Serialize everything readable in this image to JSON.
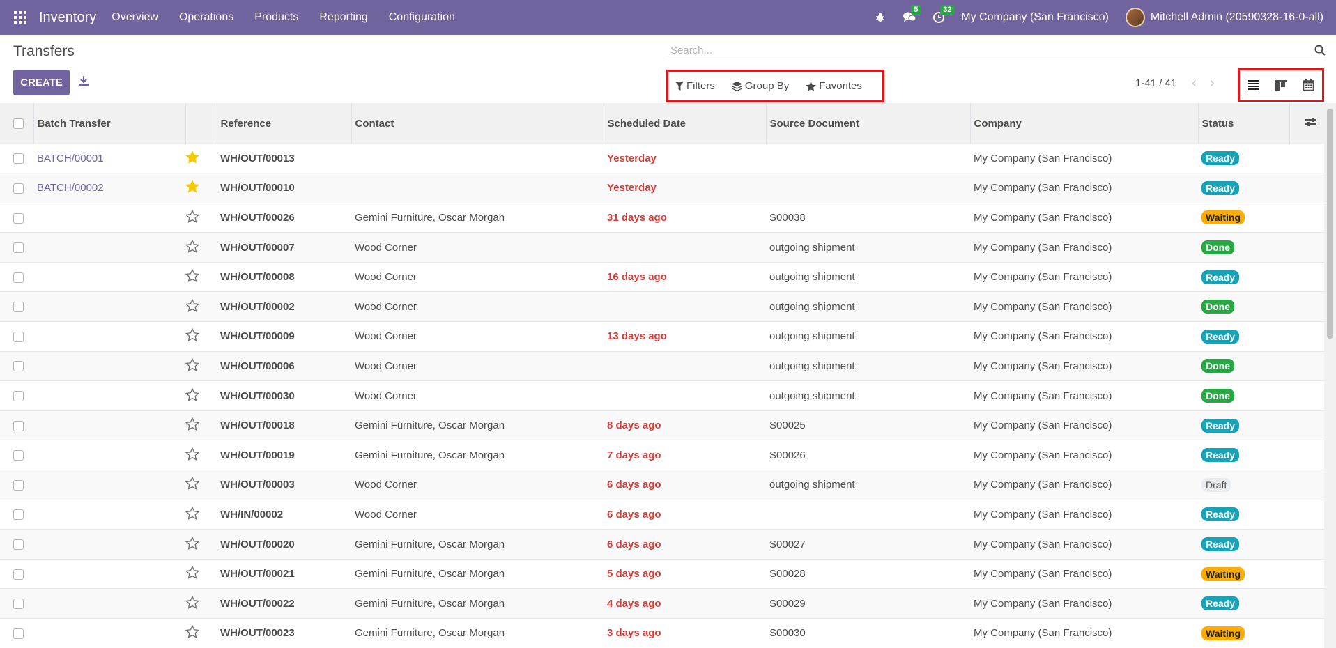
{
  "navbar": {
    "app_name": "Inventory",
    "menu": [
      "Overview",
      "Operations",
      "Products",
      "Reporting",
      "Configuration"
    ],
    "messages_count": "5",
    "activities_count": "32",
    "company": "My Company (San Francisco)",
    "user": "Mitchell Admin (20590328-16-0-all)"
  },
  "control_panel": {
    "title": "Transfers",
    "search_placeholder": "Search...",
    "create_label": "CREATE",
    "filters_label": "Filters",
    "group_by_label": "Group By",
    "favorites_label": "Favorites",
    "pager": "1-41 / 41"
  },
  "table": {
    "headers": [
      "Batch Transfer",
      "Reference",
      "Contact",
      "Scheduled Date",
      "Source Document",
      "Company",
      "Status"
    ],
    "rows": [
      {
        "batch": "BATCH/00001",
        "starred": true,
        "reference": "WH/OUT/00013",
        "contact": "",
        "date": "Yesterday",
        "source": "",
        "company": "My Company (San Francisco)",
        "status": "Ready"
      },
      {
        "batch": "BATCH/00002",
        "starred": true,
        "reference": "WH/OUT/00010",
        "contact": "",
        "date": "Yesterday",
        "source": "",
        "company": "My Company (San Francisco)",
        "status": "Ready"
      },
      {
        "batch": "",
        "starred": false,
        "reference": "WH/OUT/00026",
        "contact": "Gemini Furniture, Oscar Morgan",
        "date": "31 days ago",
        "source": "S00038",
        "company": "My Company (San Francisco)",
        "status": "Waiting"
      },
      {
        "batch": "",
        "starred": false,
        "reference": "WH/OUT/00007",
        "contact": "Wood Corner",
        "date": "",
        "source": "outgoing shipment",
        "company": "My Company (San Francisco)",
        "status": "Done"
      },
      {
        "batch": "",
        "starred": false,
        "reference": "WH/OUT/00008",
        "contact": "Wood Corner",
        "date": "16 days ago",
        "source": "outgoing shipment",
        "company": "My Company (San Francisco)",
        "status": "Ready"
      },
      {
        "batch": "",
        "starred": false,
        "reference": "WH/OUT/00002",
        "contact": "Wood Corner",
        "date": "",
        "source": "outgoing shipment",
        "company": "My Company (San Francisco)",
        "status": "Done"
      },
      {
        "batch": "",
        "starred": false,
        "reference": "WH/OUT/00009",
        "contact": "Wood Corner",
        "date": "13 days ago",
        "source": "outgoing shipment",
        "company": "My Company (San Francisco)",
        "status": "Ready"
      },
      {
        "batch": "",
        "starred": false,
        "reference": "WH/OUT/00006",
        "contact": "Wood Corner",
        "date": "",
        "source": "outgoing shipment",
        "company": "My Company (San Francisco)",
        "status": "Done"
      },
      {
        "batch": "",
        "starred": false,
        "reference": "WH/OUT/00030",
        "contact": "Wood Corner",
        "date": "",
        "source": "outgoing shipment",
        "company": "My Company (San Francisco)",
        "status": "Done"
      },
      {
        "batch": "",
        "starred": false,
        "reference": "WH/OUT/00018",
        "contact": "Gemini Furniture, Oscar Morgan",
        "date": "8 days ago",
        "source": "S00025",
        "company": "My Company (San Francisco)",
        "status": "Ready"
      },
      {
        "batch": "",
        "starred": false,
        "reference": "WH/OUT/00019",
        "contact": "Gemini Furniture, Oscar Morgan",
        "date": "7 days ago",
        "source": "S00026",
        "company": "My Company (San Francisco)",
        "status": "Ready"
      },
      {
        "batch": "",
        "starred": false,
        "reference": "WH/OUT/00003",
        "contact": "Wood Corner",
        "date": "6 days ago",
        "source": "outgoing shipment",
        "company": "My Company (San Francisco)",
        "status": "Draft"
      },
      {
        "batch": "",
        "starred": false,
        "reference": "WH/IN/00002",
        "contact": "Wood Corner",
        "date": "6 days ago",
        "source": "",
        "company": "My Company (San Francisco)",
        "status": "Ready"
      },
      {
        "batch": "",
        "starred": false,
        "reference": "WH/OUT/00020",
        "contact": "Gemini Furniture, Oscar Morgan",
        "date": "6 days ago",
        "source": "S00027",
        "company": "My Company (San Francisco)",
        "status": "Ready"
      },
      {
        "batch": "",
        "starred": false,
        "reference": "WH/OUT/00021",
        "contact": "Gemini Furniture, Oscar Morgan",
        "date": "5 days ago",
        "source": "S00028",
        "company": "My Company (San Francisco)",
        "status": "Waiting"
      },
      {
        "batch": "",
        "starred": false,
        "reference": "WH/OUT/00022",
        "contact": "Gemini Furniture, Oscar Morgan",
        "date": "4 days ago",
        "source": "S00029",
        "company": "My Company (San Francisco)",
        "status": "Ready"
      },
      {
        "batch": "",
        "starred": false,
        "reference": "WH/OUT/00023",
        "contact": "Gemini Furniture, Oscar Morgan",
        "date": "3 days ago",
        "source": "S00030",
        "company": "My Company (San Francisco)",
        "status": "Waiting"
      }
    ]
  },
  "colors": {
    "brand": "#71639e",
    "late_date": "#d23f3a",
    "ready": "#17a2b8",
    "waiting": "#ffac00",
    "done": "#28a745",
    "highlight_box": "#e0161b",
    "star_filled": "#f3cc00"
  },
  "icons": {
    "apps": "apps-grid-icon",
    "debug": "bug-icon",
    "messages": "chat-icon",
    "activities": "clock-icon",
    "search": "search-icon",
    "download": "download-icon",
    "filters": "filter-icon",
    "group_by": "layers-icon",
    "favorites": "star-icon",
    "list_view": "list-view-icon",
    "kanban_view": "kanban-view-icon",
    "calendar_view": "calendar-icon",
    "optional_columns": "sliders-icon"
  }
}
